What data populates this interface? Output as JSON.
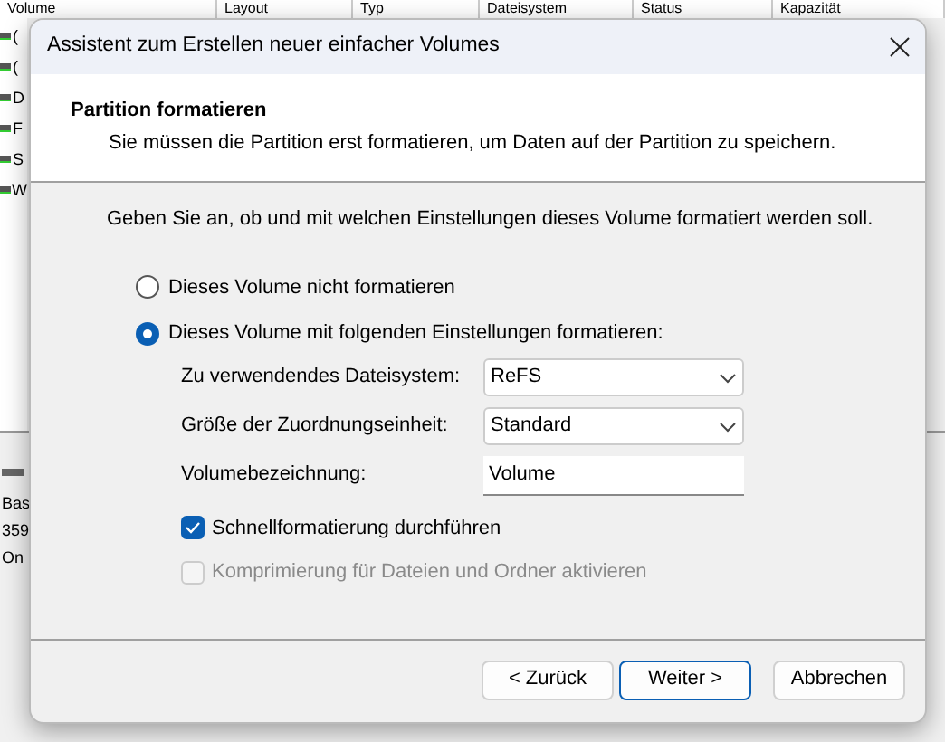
{
  "background": {
    "columns": [
      "Volume",
      "Layout",
      "Typ",
      "Dateisystem",
      "Status",
      "Kapazität"
    ],
    "volumes": [
      "(",
      "(",
      "D",
      "F",
      "S",
      "W"
    ],
    "disk": [
      "Bas",
      "359",
      "On"
    ]
  },
  "dialog": {
    "title": "Assistent zum Erstellen neuer einfacher Volumes",
    "header": {
      "title": "Partition formatieren",
      "subtitle": "Sie müssen die Partition erst formatieren, um Daten auf der Partition zu speichern."
    },
    "intro": "Geben Sie an, ob und mit welchen Einstellungen dieses Volume formatiert werden soll.",
    "options": [
      {
        "label": "Dieses Volume nicht formatieren",
        "selected": false
      },
      {
        "label": "Dieses Volume mit folgenden Einstellungen formatieren:",
        "selected": true
      }
    ],
    "fields": [
      {
        "kind": "select",
        "label": "Zu verwendendes Dateisystem:",
        "value": "ReFS"
      },
      {
        "kind": "select",
        "label": "Größe der Zuordnungseinheit:",
        "value": "Standard"
      },
      {
        "kind": "text",
        "label": "Volumebezeichnung:",
        "value": "Volume"
      }
    ],
    "checkboxes": [
      {
        "label": "Schnellformatierung durchführen",
        "checked": true,
        "disabled": false
      },
      {
        "label": "Komprimierung für Dateien und Ordner aktivieren",
        "checked": false,
        "disabled": true
      }
    ],
    "buttons": [
      {
        "label": "< Zurück",
        "default": false
      },
      {
        "label": "Weiter >",
        "default": true
      },
      {
        "label": "Abbrechen",
        "default": false
      }
    ]
  }
}
